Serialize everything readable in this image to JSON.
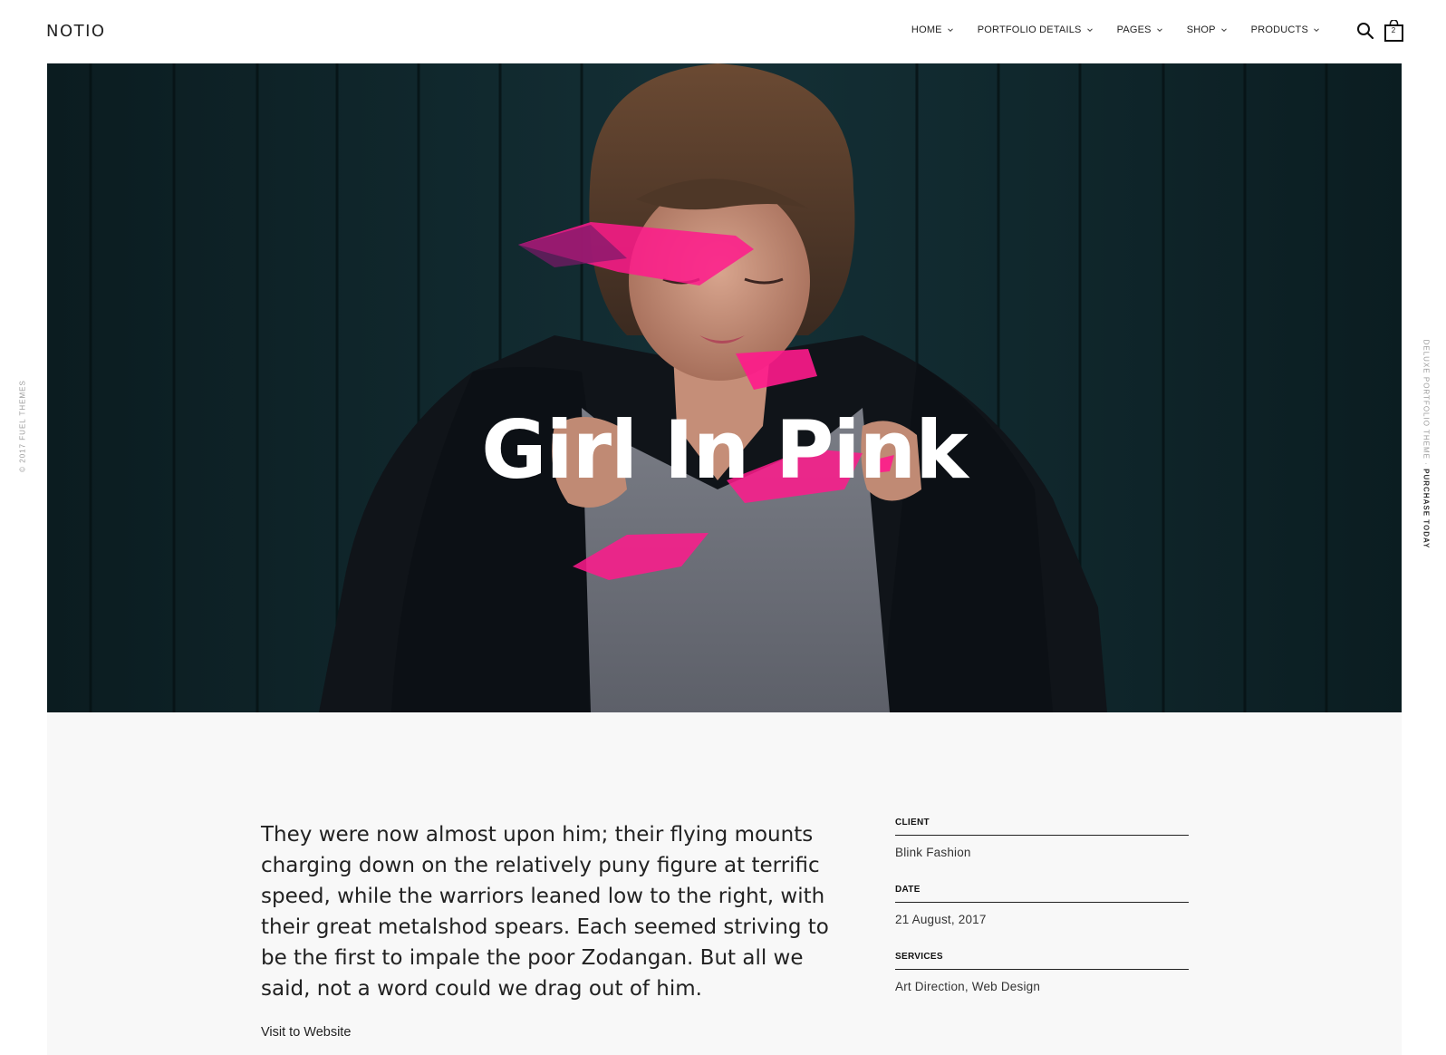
{
  "header": {
    "logo": "NOTIO",
    "nav": [
      {
        "label": "HOME"
      },
      {
        "label": "PORTFOLIO DETAILS"
      },
      {
        "label": "PAGES"
      },
      {
        "label": "SHOP"
      },
      {
        "label": "PRODUCTS"
      }
    ],
    "cart_count": "2",
    "icons": [
      "search-icon",
      "bag-icon",
      "chevron-down-icon"
    ]
  },
  "side": {
    "left_text": "© 2017 FUEL THEMES",
    "right_text": "DELUXE PORTFOLIO THEME · ",
    "right_link": "PURCHASE TODAY"
  },
  "hero": {
    "title": "Girl In Pink",
    "colors": {
      "background": "#0e2226",
      "accent": "#ff1a8c",
      "title": "#ffffff"
    }
  },
  "content": {
    "lead": "They were now almost upon him; their flying mounts charging down on the relatively puny figure at terrific speed, while the warriors leaned low to the right, with their great metalshod spears. Each seemed striving to be the first to impale the poor Zodangan. But all we said, not a word could we drag out of him.",
    "visit_link": "Visit to Website",
    "meta": [
      {
        "label": "CLIENT",
        "value": "Blink Fashion"
      },
      {
        "label": "DATE",
        "value": "21 August, 2017"
      },
      {
        "label": "SERVICES",
        "value": "Art Direction, Web Design"
      }
    ]
  }
}
